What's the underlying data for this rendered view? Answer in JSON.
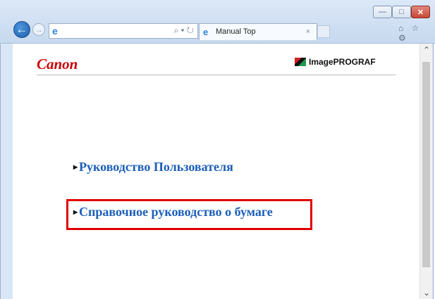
{
  "browser": {
    "tab_title": "Manual Top",
    "controls": [
      "minimize",
      "maximize",
      "close"
    ]
  },
  "page": {
    "brand_left": "Canon",
    "brand_right": "ImagePROGRAF",
    "link_user_guide": "Руководство Пользователя",
    "link_paper_reference": "Справочное руководство о бумаге"
  },
  "colors": {
    "brand_red": "#cc0000",
    "link_blue": "#1b5eb9",
    "highlight_red": "#e00000"
  }
}
